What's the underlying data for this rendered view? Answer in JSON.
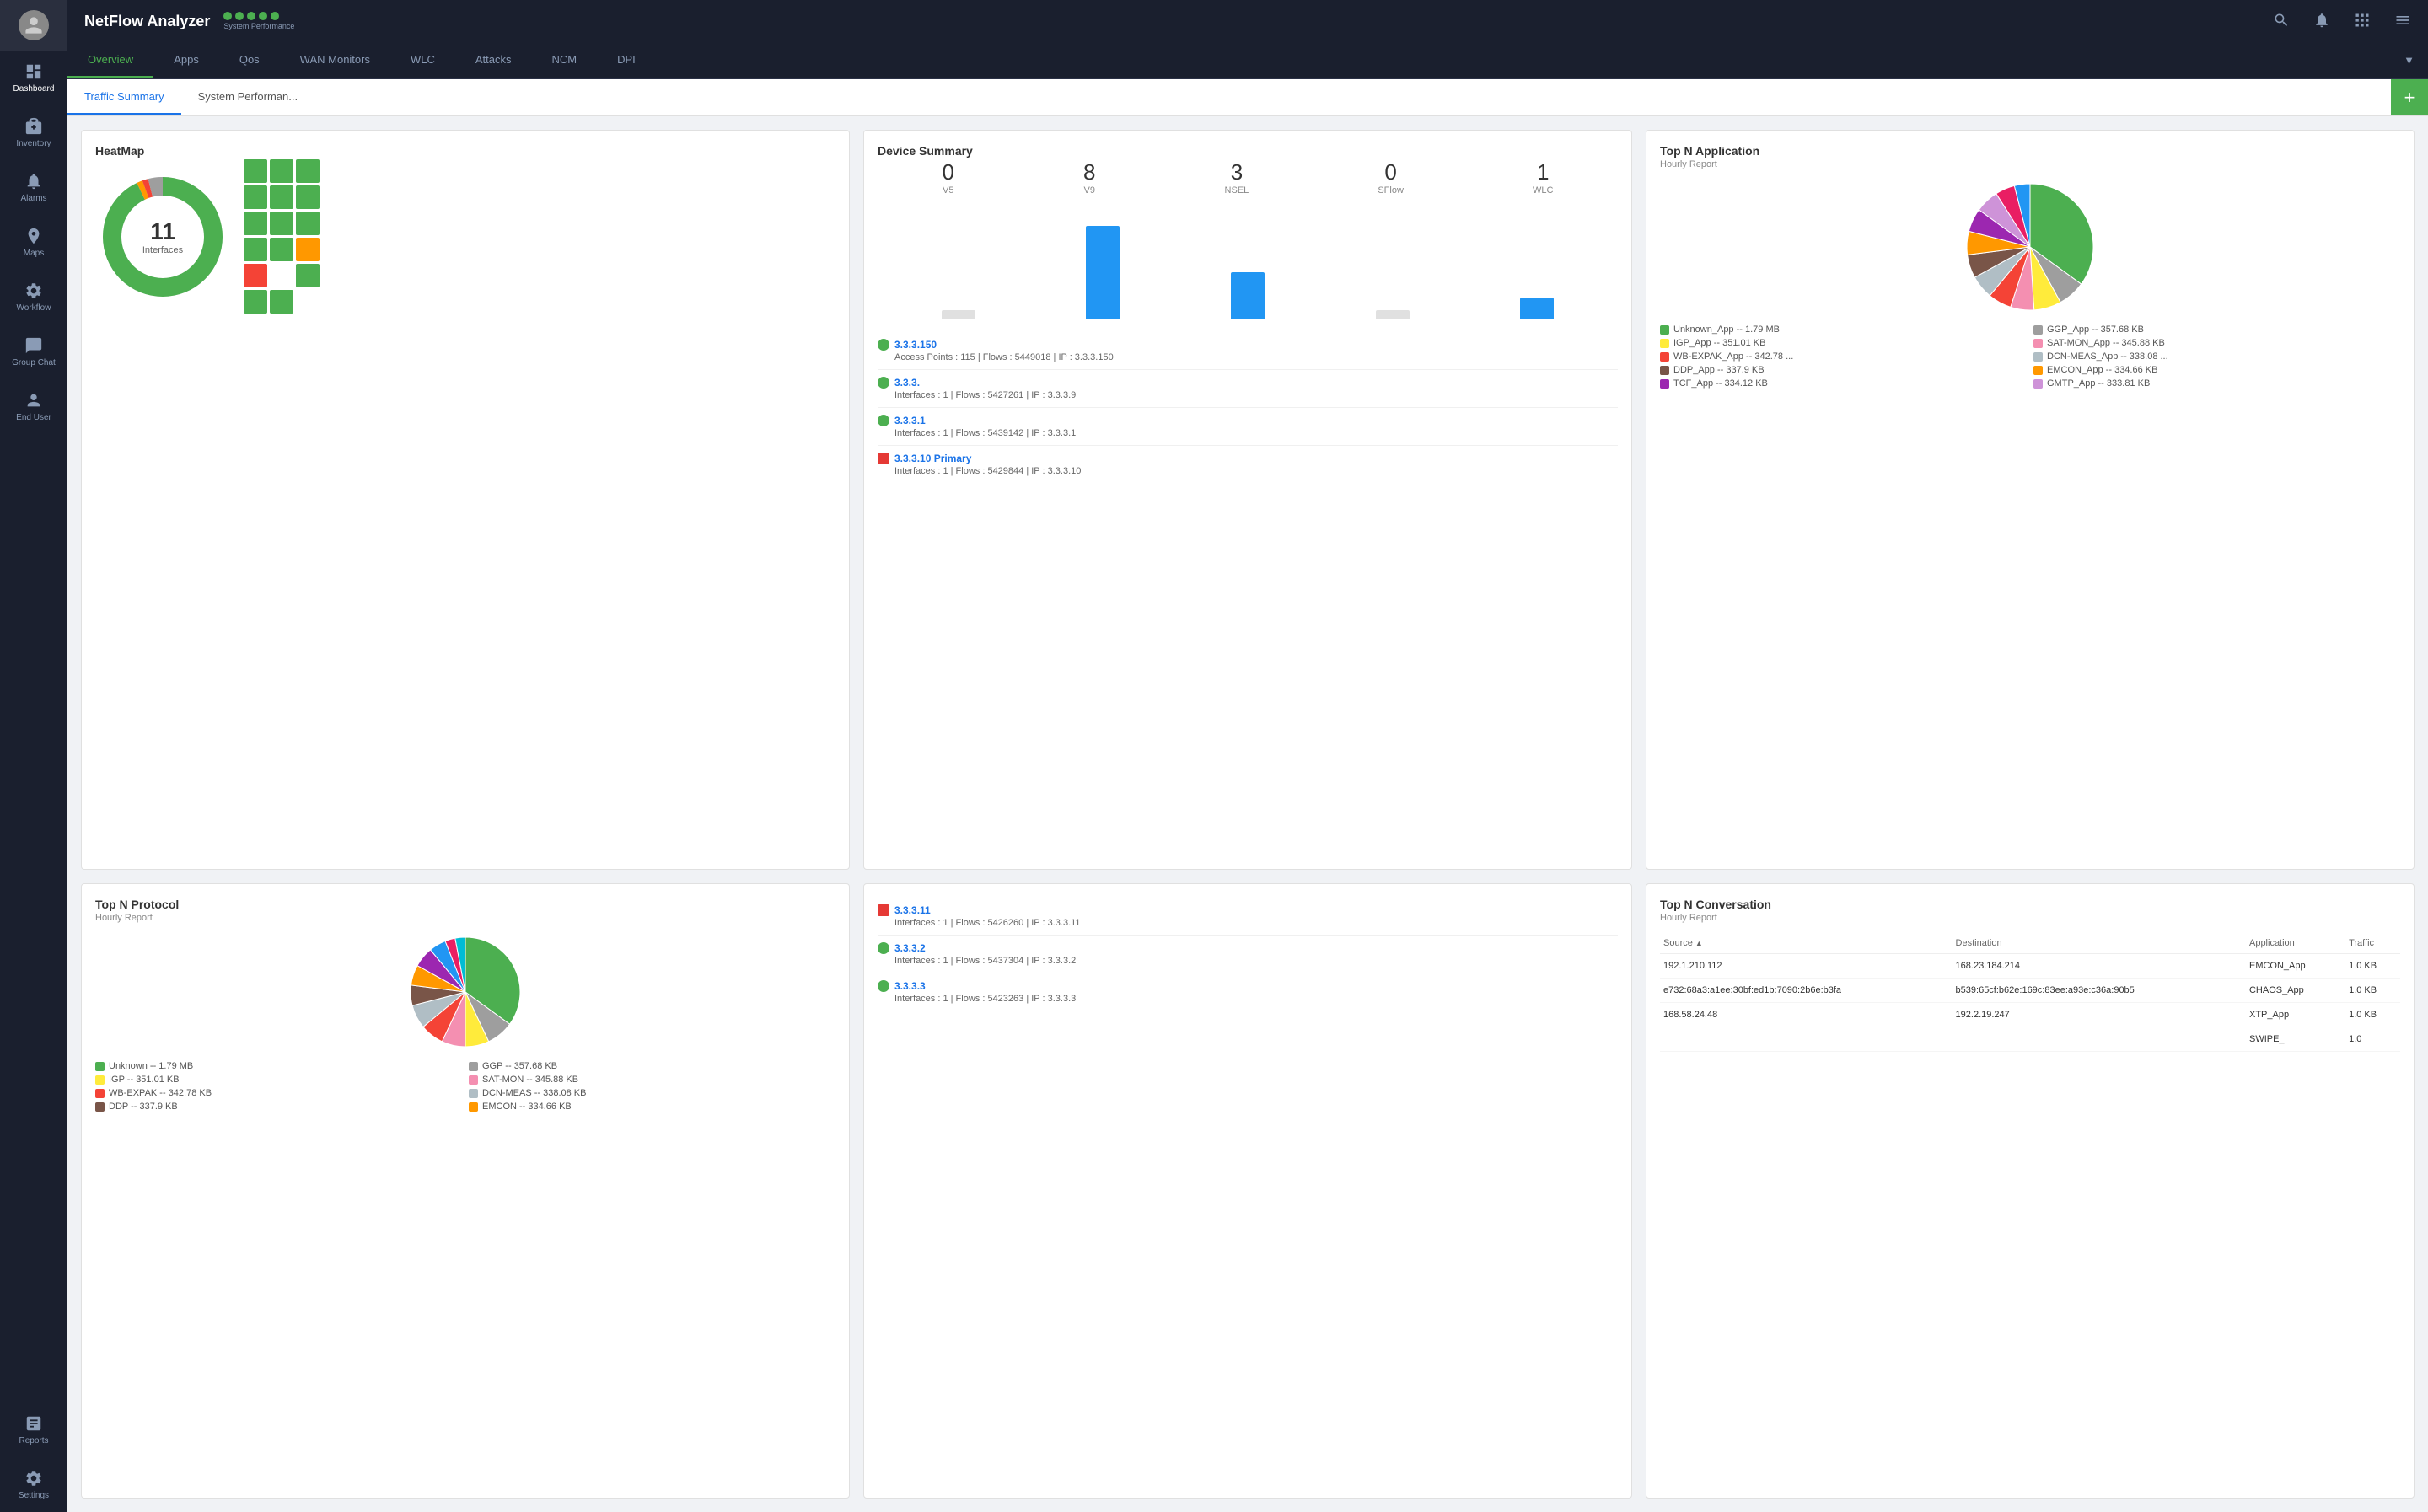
{
  "app": {
    "title": "NetFlow Analyzer",
    "status_label": "System Performance",
    "status_dots": 5
  },
  "sidebar": {
    "items": [
      {
        "id": "dashboard",
        "label": "Dashboard",
        "active": true
      },
      {
        "id": "inventory",
        "label": "Inventory",
        "active": false
      },
      {
        "id": "alarms",
        "label": "Alarms",
        "active": false
      },
      {
        "id": "maps",
        "label": "Maps",
        "active": false
      },
      {
        "id": "workflow",
        "label": "Workflow",
        "active": false
      },
      {
        "id": "groupchat",
        "label": "Group Chat",
        "active": false
      },
      {
        "id": "enduser",
        "label": "End User",
        "active": false
      }
    ],
    "bottom_items": [
      {
        "id": "reports",
        "label": "Reports"
      },
      {
        "id": "settings",
        "label": "Settings"
      }
    ]
  },
  "navtabs": {
    "items": [
      {
        "id": "overview",
        "label": "Overview",
        "active": true
      },
      {
        "id": "apps",
        "label": "Apps",
        "active": false
      },
      {
        "id": "qos",
        "label": "Qos",
        "active": false
      },
      {
        "id": "wan",
        "label": "WAN Monitors",
        "active": false
      },
      {
        "id": "wlc",
        "label": "WLC",
        "active": false
      },
      {
        "id": "attacks",
        "label": "Attacks",
        "active": false
      },
      {
        "id": "ncm",
        "label": "NCM",
        "active": false
      },
      {
        "id": "dpi",
        "label": "DPI",
        "active": false
      }
    ],
    "more_label": "▼"
  },
  "subtabs": {
    "items": [
      {
        "id": "traffic",
        "label": "Traffic Summary",
        "active": true
      },
      {
        "id": "sysperf",
        "label": "System Performan...",
        "active": false
      }
    ],
    "add_label": "+"
  },
  "heatmap": {
    "title": "HeatMap",
    "count": "11",
    "label": "Interfaces",
    "cells": [
      1,
      1,
      1,
      1,
      1,
      1,
      1,
      1,
      1,
      1,
      1,
      1,
      1,
      0,
      1,
      1,
      1,
      0
    ]
  },
  "device_summary": {
    "title": "Device Summary",
    "stats": [
      {
        "num": "0",
        "label": "V5"
      },
      {
        "num": "8",
        "label": "V9"
      },
      {
        "num": "3",
        "label": "NSEL"
      },
      {
        "num": "0",
        "label": "SFlow"
      },
      {
        "num": "1",
        "label": "WLC"
      }
    ],
    "bars": [
      {
        "height": 10,
        "type": "gray"
      },
      {
        "height": 110,
        "type": "blue"
      },
      {
        "height": 55,
        "type": "blue"
      },
      {
        "height": 10,
        "type": "gray"
      },
      {
        "height": 25,
        "type": "blue"
      }
    ],
    "devices": [
      {
        "name": "3.3.3.150",
        "type": "green",
        "meta": "Access Points : 115 | Flows : 5449018 | IP : 3.3.3.150"
      },
      {
        "name": "3.3.3.",
        "type": "green",
        "meta": "Interfaces : 1 | Flows : 5427261 | IP : 3.3.3.9"
      },
      {
        "name": "3.3.3.1",
        "type": "green",
        "meta": "Interfaces : 1 | Flows : 5439142 | IP : 3.3.3.1"
      },
      {
        "name": "3.3.3.10 Primary",
        "type": "red",
        "meta": "Interfaces : 1 | Flows : 5429844 | IP : 3.3.3.10"
      },
      {
        "name": "3.3.3.11",
        "type": "red",
        "meta": "Interfaces : 1 | Flows : 5426260 | IP : 3.3.3.11"
      },
      {
        "name": "3.3.3.2",
        "type": "green",
        "meta": "Interfaces : 1 | Flows : 5437304 | IP : 3.3.3.2"
      },
      {
        "name": "3.3.3.3",
        "type": "green",
        "meta": "Interfaces : 1 | Flows : 5423263 | IP : 3.3.3.3"
      }
    ]
  },
  "topn_app": {
    "title": "Top N Application",
    "subtitle": "Hourly Report",
    "legend": [
      {
        "color": "#4caf50",
        "label": "Unknown_App -- 1.79 MB"
      },
      {
        "color": "#9e9e9e",
        "label": "GGP_App -- 357.68 KB"
      },
      {
        "color": "#ffeb3b",
        "label": "IGP_App -- 351.01 KB"
      },
      {
        "color": "#f48fb1",
        "label": "SAT-MON_App -- 345.88 KB"
      },
      {
        "color": "#f44336",
        "label": "WB-EXPAK_App -- 342.78 ..."
      },
      {
        "color": "#b0bec5",
        "label": "DCN-MEAS_App -- 338.08 ..."
      },
      {
        "color": "#795548",
        "label": "DDP_App -- 337.9 KB"
      },
      {
        "color": "#ff9800",
        "label": "EMCON_App -- 334.66 KB"
      },
      {
        "color": "#9c27b0",
        "label": "TCF_App -- 334.12 KB"
      },
      {
        "color": "#ce93d8",
        "label": "GMTP_App -- 333.81 KB"
      }
    ],
    "pie_slices": [
      {
        "color": "#4caf50",
        "value": 35
      },
      {
        "color": "#9e9e9e",
        "value": 7
      },
      {
        "color": "#ffeb3b",
        "value": 7
      },
      {
        "color": "#f48fb1",
        "value": 6
      },
      {
        "color": "#f44336",
        "value": 6
      },
      {
        "color": "#b0bec5",
        "value": 6
      },
      {
        "color": "#795548",
        "value": 6
      },
      {
        "color": "#ff9800",
        "value": 6
      },
      {
        "color": "#9c27b0",
        "value": 6
      },
      {
        "color": "#ce93d8",
        "value": 6
      },
      {
        "color": "#e91e63",
        "value": 5
      },
      {
        "color": "#2196f3",
        "value": 4
      }
    ]
  },
  "topn_proto": {
    "title": "Top N Protocol",
    "subtitle": "Hourly Report",
    "legend": [
      {
        "color": "#4caf50",
        "label": "Unknown -- 1.79 MB"
      },
      {
        "color": "#9e9e9e",
        "label": "GGP -- 357.68 KB"
      },
      {
        "color": "#ffeb3b",
        "label": "IGP -- 351.01 KB"
      },
      {
        "color": "#f48fb1",
        "label": "SAT-MON -- 345.88 KB"
      },
      {
        "color": "#f44336",
        "label": "WB-EXPAK -- 342.78 KB"
      },
      {
        "color": "#b0bec5",
        "label": "DCN-MEAS -- 338.08 KB"
      },
      {
        "color": "#795548",
        "label": "DDP -- 337.9 KB"
      },
      {
        "color": "#ff9800",
        "label": "EMCON -- 334.66 KB"
      }
    ],
    "pie_slices": [
      {
        "color": "#4caf50",
        "value": 35
      },
      {
        "color": "#9e9e9e",
        "value": 8
      },
      {
        "color": "#ffeb3b",
        "value": 7
      },
      {
        "color": "#f48fb1",
        "value": 7
      },
      {
        "color": "#f44336",
        "value": 7
      },
      {
        "color": "#b0bec5",
        "value": 7
      },
      {
        "color": "#795548",
        "value": 6
      },
      {
        "color": "#ff9800",
        "value": 6
      },
      {
        "color": "#9c27b0",
        "value": 6
      },
      {
        "color": "#2196f3",
        "value": 5
      },
      {
        "color": "#e91e63",
        "value": 3
      },
      {
        "color": "#00bcd4",
        "value": 3
      }
    ]
  },
  "topn_conv": {
    "title": "Top N Conversation",
    "subtitle": "Hourly Report",
    "columns": [
      "Source",
      "Destination",
      "Application",
      "Traffic"
    ],
    "rows": [
      {
        "source": "192.1.210.112",
        "dest": "168.23.184.214",
        "app": "EMCON_App",
        "traffic": "1.0 KB"
      },
      {
        "source": "e732:68a3:a1ee:30bf:ed1b:7090:2b6e:b3fa",
        "dest": "b539:65cf:b62e:169c:83ee:a93e:c36a:90b5",
        "app": "CHAOS_App",
        "traffic": "1.0 KB"
      },
      {
        "source": "168.58.24.48",
        "dest": "192.2.19.247",
        "app": "XTP_App",
        "traffic": "1.0 KB"
      },
      {
        "source": "",
        "dest": "",
        "app": "SWIPE_",
        "traffic": "1.0"
      }
    ]
  }
}
